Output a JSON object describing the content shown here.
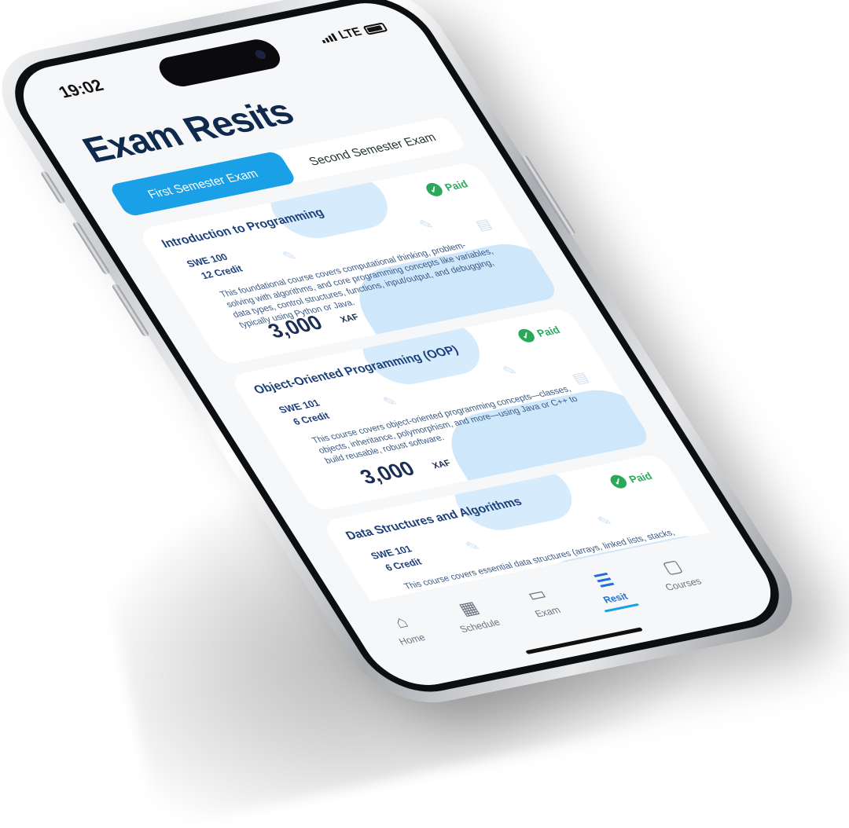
{
  "status": {
    "time": "19:02",
    "network": "LTE"
  },
  "title": "Exam Resits",
  "tabs": [
    {
      "label": "First Semester Exam",
      "active": true
    },
    {
      "label": "Second Semester Exam",
      "active": false
    }
  ],
  "courses": [
    {
      "title": "Introduction to Programming",
      "status": "Paid",
      "code": "SWE 100",
      "credit": "12 Credit",
      "description": "This foundational course covers computational thinking, problem-solving with algorithms, and core programming concepts like variables, data types, control structures, functions, input/output, and debugging, typically using Python or Java.",
      "price": "3,000",
      "currency": "XAF"
    },
    {
      "title": "Object-Oriented Programming (OOP)",
      "status": "Paid",
      "code": "SWE 101",
      "credit": "6 Credit",
      "description": "This course covers object-oriented programming concepts—classes, objects, inheritance, polymorphism, and more—using Java or C++ to build reusable, robust software.",
      "price": "3,000",
      "currency": "XAF"
    },
    {
      "title": "Data Structures and Algorithms",
      "status": "Paid",
      "code": "SWE 101",
      "credit": "6 Credit",
      "description": "This course covers essential data structures (arrays, linked lists, stacks, queues, trees, graphs, hash tables) and algorithms (sorting, searching, traversal), focusing on understanding complexity for efficient problem-solving.",
      "price": "",
      "currency": ""
    }
  ],
  "nav": [
    {
      "label": "Home",
      "icon": "home-icon",
      "active": false
    },
    {
      "label": "Schedule",
      "icon": "calendar-icon",
      "active": false
    },
    {
      "label": "Exam",
      "icon": "grade-icon",
      "active": false
    },
    {
      "label": "Resit",
      "icon": "resit-icon",
      "active": true
    },
    {
      "label": "Courses",
      "icon": "book-icon",
      "active": false
    }
  ],
  "colors": {
    "accent": "#1aa0e6",
    "title": "#0f2a4d",
    "paid": "#2aa95b"
  }
}
